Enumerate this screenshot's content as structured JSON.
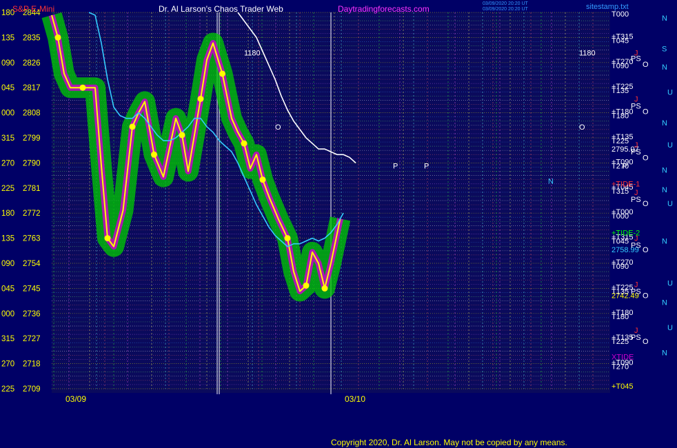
{
  "header": {
    "instrument": "S&P E-Mini",
    "title": "Dr. Al Larson's Chaos Trader Web",
    "site": "Daytradingforecasts.com",
    "stamp_line1": "03/09/2020 20:20 UT",
    "stamp_line2": "03/09/2020 20:20 UT",
    "corner": "sitestamp.txt"
  },
  "copyright": "Copyright 2020, Dr. Al Larson. May not be copied by any means.",
  "colors": {
    "background": "#000066",
    "price_axis": "#ffff00",
    "yellow_line": "#ffff00",
    "cyan_line": "#33ccff",
    "white_line": "#ffffff",
    "green_band": "#00cc00",
    "magenta": "#cc00cc",
    "title_red": "#ff3333",
    "title_site": "#ff33ff"
  },
  "chart_data": {
    "type": "line",
    "title": "Dr. Al Larson's Chaos Trader Web",
    "ylim": [
      2709,
      2844
    ],
    "x_labels": [
      "03/09",
      "03/10"
    ],
    "y_ticks": [
      {
        "deg": "180",
        "price": 2844
      },
      {
        "deg": "135",
        "price": 2835
      },
      {
        "deg": "090",
        "price": 2826
      },
      {
        "deg": "045",
        "price": 2817
      },
      {
        "deg": "000",
        "price": 2808
      },
      {
        "deg": "315",
        "price": 2799
      },
      {
        "deg": "270",
        "price": 2790
      },
      {
        "deg": "225",
        "price": 2781
      },
      {
        "deg": "180",
        "price": 2772
      },
      {
        "deg": "135",
        "price": 2763
      },
      {
        "deg": "090",
        "price": 2754
      },
      {
        "deg": "045",
        "price": 2745
      },
      {
        "deg": "000",
        "price": 2736
      },
      {
        "deg": "315",
        "price": 2727
      },
      {
        "deg": "270",
        "price": 2718
      },
      {
        "deg": "225",
        "price": 2709
      }
    ],
    "series": [
      {
        "color": "#ffff00",
        "x": [
          0,
          2,
          4,
          6,
          10,
          14,
          16,
          18,
          20,
          23,
          26,
          28,
          30,
          33,
          36,
          40,
          42,
          44,
          46,
          48,
          50,
          52,
          55,
          58,
          60,
          62,
          64,
          66,
          68,
          70,
          73,
          76,
          78,
          80,
          82,
          84,
          86,
          88,
          90,
          93
        ],
        "values": [
          2843,
          2835,
          2822,
          2817,
          2817,
          2817,
          2789,
          2763,
          2760,
          2773,
          2803,
          2808,
          2812,
          2793,
          2785,
          2806,
          2800,
          2787,
          2800,
          2813,
          2827,
          2833,
          2822,
          2806,
          2801,
          2797,
          2788,
          2793,
          2784,
          2778,
          2770,
          2763,
          2751,
          2744,
          2746,
          2758,
          2754,
          2745,
          2754,
          2770
        ]
      },
      {
        "color": "#33ccff",
        "x": [
          12,
          14,
          16,
          18,
          20,
          22,
          24,
          26,
          28,
          30,
          32,
          34,
          36,
          38,
          40,
          42,
          44,
          46,
          48,
          50,
          52,
          54,
          56,
          58,
          60,
          62,
          64,
          66,
          68,
          70,
          72,
          74,
          76,
          78,
          80,
          82,
          84,
          86,
          88,
          90,
          92,
          94
        ],
        "values": [
          2844,
          2843,
          2833,
          2820,
          2810,
          2807,
          2806,
          2806,
          2808,
          2806,
          2803,
          2800,
          2798,
          2798,
          2799,
          2801,
          2803,
          2806,
          2806,
          2803,
          2801,
          2798,
          2796,
          2794,
          2790,
          2785,
          2780,
          2775,
          2771,
          2767,
          2764,
          2762,
          2760,
          2761,
          2761,
          2762,
          2763,
          2762,
          2763,
          2765,
          2768,
          2772
        ]
      },
      {
        "color": "#ffffff",
        "x": [
          60,
          62,
          64,
          66,
          68,
          70,
          72,
          74,
          76,
          78,
          80,
          82,
          84,
          86,
          88,
          90,
          92,
          94,
          96,
          98
        ],
        "values": [
          2844,
          2841,
          2838,
          2835,
          2830,
          2825,
          2820,
          2814,
          2809,
          2805,
          2802,
          2799,
          2797,
          2795,
          2795,
          2794,
          2793,
          2793,
          2792,
          2790
        ]
      }
    ],
    "levels": [
      {
        "label": "2795.07",
        "price": 2795.07,
        "color": "#ffffff"
      },
      {
        "label": "2758.99",
        "price": 2758.99,
        "color": "#33ccff"
      },
      {
        "label": "2742.49",
        "price": 2742.49,
        "color": "#ffff00"
      }
    ]
  },
  "right_labels": [
    {
      "text": "T000",
      "price": 2843.5,
      "color": "#ffffff"
    },
    {
      "text": "+T315",
      "price": 2835.5,
      "color": "#ffffff"
    },
    {
      "text": "T045",
      "price": 2834,
      "color": "#ffffff"
    },
    {
      "text": "+T270",
      "price": 2826.5,
      "color": "#ffffff"
    },
    {
      "text": "T090",
      "price": 2825,
      "color": "#ffffff"
    },
    {
      "text": "+T225",
      "price": 2817.5,
      "color": "#ffffff"
    },
    {
      "text": "T135",
      "price": 2816,
      "color": "#ffffff"
    },
    {
      "text": "+T180",
      "price": 2808.5,
      "color": "#ffffff"
    },
    {
      "text": "T180",
      "price": 2807,
      "color": "#ffffff"
    },
    {
      "text": "+T135",
      "price": 2799.5,
      "color": "#ffffff"
    },
    {
      "text": "T225",
      "price": 2798,
      "color": "#ffffff"
    },
    {
      "text": "+T090",
      "price": 2790.5,
      "color": "#ffffff"
    },
    {
      "text": "T270",
      "price": 2789,
      "color": "#ffffff"
    },
    {
      "text": "+T045",
      "price": 2781.5,
      "color": "#ffffff"
    },
    {
      "text": "T315",
      "price": 2780,
      "color": "#ffffff"
    },
    {
      "text": "+T000",
      "price": 2772.5,
      "color": "#ffffff"
    },
    {
      "text": "T000",
      "price": 2771,
      "color": "#ffffff"
    },
    {
      "text": "+T315",
      "price": 2763.5,
      "color": "#ffffff"
    },
    {
      "text": "T045",
      "price": 2762,
      "color": "#ffffff"
    },
    {
      "text": "+T270",
      "price": 2754.5,
      "color": "#ffffff"
    },
    {
      "text": "T090",
      "price": 2753,
      "color": "#ffffff"
    },
    {
      "text": "+T225",
      "price": 2745.5,
      "color": "#ffffff"
    },
    {
      "text": "T135",
      "price": 2744,
      "color": "#ffffff"
    },
    {
      "text": "+T180",
      "price": 2736.5,
      "color": "#ffffff"
    },
    {
      "text": "T180",
      "price": 2735,
      "color": "#ffffff"
    },
    {
      "text": "+T135",
      "price": 2727.5,
      "color": "#ffffff"
    },
    {
      "text": "T225",
      "price": 2726,
      "color": "#ffffff"
    },
    {
      "text": "+T090",
      "price": 2718.5,
      "color": "#ffffff"
    },
    {
      "text": "T270",
      "price": 2717,
      "color": "#ffffff"
    },
    {
      "text": "+T045",
      "price": 2710,
      "color": "#ffff00"
    },
    {
      "text": "+TIDE-1",
      "price": 2782.5,
      "color": "#ff3333"
    },
    {
      "text": "+TIDE-2",
      "price": 2765,
      "color": "#00ff00"
    },
    {
      "text": "XTIDE",
      "price": 2720.5,
      "color": "#cc00cc"
    }
  ],
  "planet_labels": [
    {
      "text": "N",
      "price": 2842,
      "color": "#33ccff"
    },
    {
      "text": "S",
      "price": 2831,
      "color": "#33ccff"
    },
    {
      "text": "N",
      "price": 2824.5,
      "color": "#33ccff"
    },
    {
      "text": "U",
      "price": 2815.5,
      "color": "#33ccff"
    },
    {
      "text": "N",
      "price": 2804.5,
      "color": "#33ccff"
    },
    {
      "text": "U",
      "price": 2796.5,
      "color": "#33ccff"
    },
    {
      "text": "N",
      "price": 2787.5,
      "color": "#33ccff"
    },
    {
      "text": "N",
      "price": 2780.5,
      "color": "#33ccff"
    },
    {
      "text": "U",
      "price": 2775.5,
      "color": "#33ccff"
    },
    {
      "text": "N",
      "price": 2762,
      "color": "#33ccff"
    },
    {
      "text": "U",
      "price": 2747,
      "color": "#33ccff"
    },
    {
      "text": "N",
      "price": 2740,
      "color": "#33ccff"
    },
    {
      "text": "U",
      "price": 2731,
      "color": "#33ccff"
    },
    {
      "text": "N",
      "price": 2722,
      "color": "#33ccff"
    },
    {
      "text": "PS",
      "price": 2827.5,
      "color": "#ffffff"
    },
    {
      "text": "PS",
      "price": 2810.5,
      "color": "#ffffff"
    },
    {
      "text": "PS",
      "price": 2794,
      "color": "#ffffff"
    },
    {
      "text": "PS",
      "price": 2777,
      "color": "#ffffff"
    },
    {
      "text": "PS",
      "price": 2760.5,
      "color": "#ffffff"
    },
    {
      "text": "PS",
      "price": 2744,
      "color": "#ffffff"
    },
    {
      "text": "PS",
      "price": 2727.5,
      "color": "#ffffff"
    },
    {
      "text": "O",
      "price": 2825.5,
      "color": "#ffffff"
    },
    {
      "text": "O",
      "price": 2808.5,
      "color": "#ffffff"
    },
    {
      "text": "O",
      "price": 2792,
      "color": "#ffffff"
    },
    {
      "text": "O",
      "price": 2775.5,
      "color": "#ffffff"
    },
    {
      "text": "O",
      "price": 2759,
      "color": "#ffffff"
    },
    {
      "text": "O",
      "price": 2742.5,
      "color": "#ffffff"
    },
    {
      "text": "O",
      "price": 2726,
      "color": "#ffffff"
    },
    {
      "text": "J",
      "price": 2829.5,
      "color": "#ff3333"
    },
    {
      "text": "J",
      "price": 2813,
      "color": "#ff3333"
    },
    {
      "text": "J",
      "price": 2796.5,
      "color": "#ff3333"
    },
    {
      "text": "J",
      "price": 2779.5,
      "color": "#ff3333"
    },
    {
      "text": "J",
      "price": 2763,
      "color": "#ff3333"
    },
    {
      "text": "J",
      "price": 2746.5,
      "color": "#ff3333"
    },
    {
      "text": "J",
      "price": 2730,
      "color": "#ff3333"
    }
  ],
  "chart_annotations": [
    {
      "text": "1180",
      "x": 62,
      "price": 2829.5,
      "color": "#ffffff"
    },
    {
      "text": "1180",
      "x": 170,
      "price": 2829.5,
      "color": "#ffffff"
    },
    {
      "text": "O",
      "x": 72,
      "price": 2803,
      "color": "#ffffff"
    },
    {
      "text": "O",
      "x": 170,
      "price": 2803,
      "color": "#ffffff"
    },
    {
      "text": "P",
      "x": 110,
      "price": 2789,
      "color": "#ffffff"
    },
    {
      "text": "P",
      "x": 120,
      "price": 2789,
      "color": "#ffffff"
    },
    {
      "text": "N",
      "x": 160,
      "price": 2783.5,
      "color": "#33ccff"
    },
    {
      "text": "P",
      "x": 184,
      "price": 2789,
      "color": "#ffffff"
    }
  ]
}
